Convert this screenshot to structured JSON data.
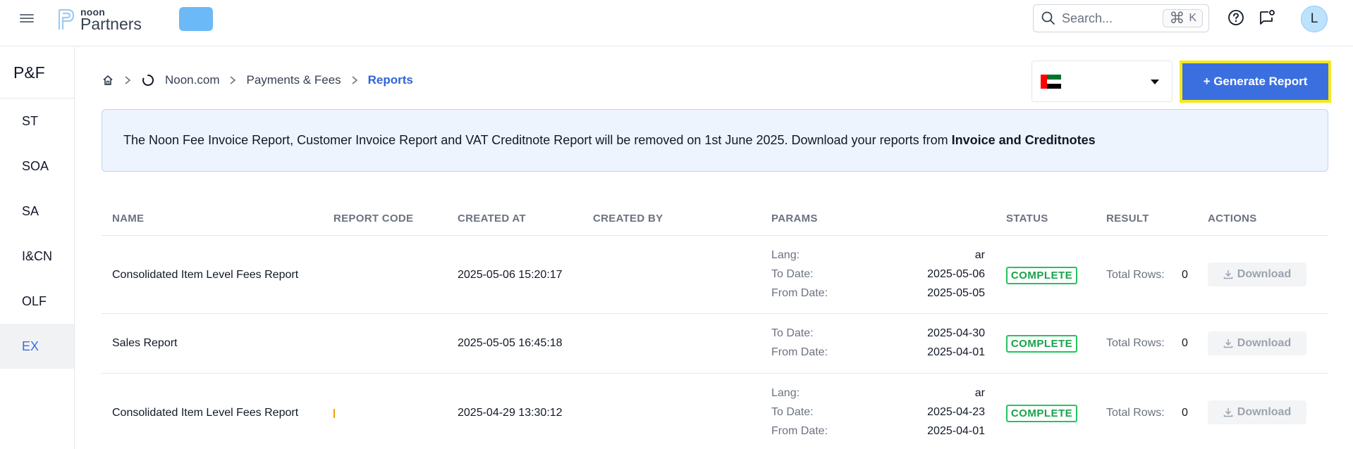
{
  "header": {
    "logo_small": "noon",
    "logo_big": "Partners",
    "search": {
      "placeholder": "Search...",
      "shortcut_key": "K",
      "shortcut_mod": "⌘"
    },
    "avatar_initial": "L"
  },
  "sidebar": {
    "title": "P&F",
    "items": [
      {
        "label": "ST",
        "active": false
      },
      {
        "label": "SOA",
        "active": false
      },
      {
        "label": "SA",
        "active": false
      },
      {
        "label": "I&CN",
        "active": false
      },
      {
        "label": "OLF",
        "active": false
      },
      {
        "label": "EX",
        "active": true
      }
    ]
  },
  "breadcrumb": {
    "items": [
      "Noon.com",
      "Payments & Fees"
    ],
    "current": "Reports"
  },
  "country_select": {
    "selected": "UAE flag"
  },
  "generate_button": {
    "label": "+ Generate Report"
  },
  "notice": {
    "text": "The Noon Fee Invoice Report, Customer Invoice Report and VAT Creditnote Report will be removed on 1st June 2025. Download your reports from ",
    "link": "Invoice and Creditnotes"
  },
  "table": {
    "columns": [
      "NAME",
      "REPORT CODE",
      "CREATED AT",
      "CREATED BY",
      "PARAMS",
      "STATUS",
      "RESULT",
      "ACTIONS"
    ],
    "rows": [
      {
        "name": "Consolidated Item Level Fees Report",
        "report_code": "",
        "created_at": "2025-05-06 15:20:17",
        "created_by": "",
        "params": [
          {
            "label": "Lang:",
            "value": "ar"
          },
          {
            "label": "To Date:",
            "value": "2025-05-06"
          },
          {
            "label": "From Date:",
            "value": "2025-05-05"
          }
        ],
        "status": "COMPLETE",
        "result_label": "Total Rows:",
        "result_value": "0",
        "action": "Download"
      },
      {
        "name": "Sales Report",
        "report_code": "",
        "created_at": "2025-05-05 16:45:18",
        "created_by": "",
        "params": [
          {
            "label": "To Date:",
            "value": "2025-04-30"
          },
          {
            "label": "From Date:",
            "value": "2025-04-01"
          }
        ],
        "status": "COMPLETE",
        "result_label": "Total Rows:",
        "result_value": "0",
        "action": "Download"
      },
      {
        "name": "Consolidated Item Level Fees Report",
        "report_code": "",
        "created_at": "2025-04-29 13:30:12",
        "created_by": "",
        "params": [
          {
            "label": "Lang:",
            "value": "ar"
          },
          {
            "label": "To Date:",
            "value": "2025-04-23"
          },
          {
            "label": "From Date:",
            "value": "2025-04-01"
          }
        ],
        "status": "COMPLETE",
        "result_label": "Total Rows:",
        "result_value": "0",
        "action": "Download"
      }
    ]
  },
  "colors": {
    "accent": "#3b6fe0",
    "highlight_border": "#f7e81c",
    "status_complete": "#22c55e",
    "notice_bg": "#eef4fd"
  }
}
